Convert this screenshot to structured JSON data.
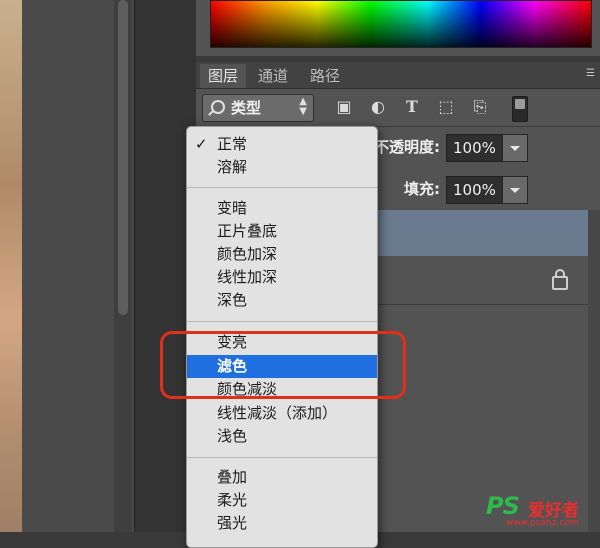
{
  "panel": {
    "tabs": [
      "图层",
      "通道",
      "路径"
    ],
    "filter": {
      "label": "类型"
    },
    "opacity": {
      "label": "不透明度:",
      "value": "100%"
    },
    "fill": {
      "label": "填充:",
      "value": "100%"
    }
  },
  "blend_menu": {
    "groups": [
      [
        "正常",
        "溶解"
      ],
      [
        "变暗",
        "正片叠底",
        "颜色加深",
        "线性加深",
        "深色"
      ],
      [
        "变亮",
        "滤色",
        "颜色减淡",
        "线性减淡（添加）",
        "浅色"
      ],
      [
        "叠加",
        "柔光",
        "强光"
      ]
    ],
    "checked_item": "正常",
    "highlighted_item": "滤色",
    "highlight_color": "#1f6fe0"
  },
  "callout": {
    "color": "#e0301a"
  },
  "watermark": {
    "logo": "PS",
    "name": "爱好者",
    "url": "www.psahz.com"
  },
  "icons": [
    "search-icon",
    "image-filter-icon",
    "adjustment-filter-icon",
    "type-filter-icon",
    "shape-filter-icon",
    "smart-object-filter-icon",
    "filter-toggle",
    "lock-icon",
    "panel-menu-icon",
    "check-icon"
  ]
}
